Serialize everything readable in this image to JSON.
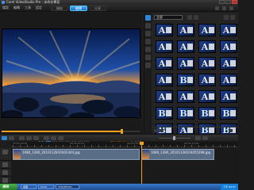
{
  "window": {
    "title": "Corel VideoStudio Pro - 未命名專案"
  },
  "menubar": {
    "menus": [
      "檔案",
      "編輯",
      "工具",
      "設定"
    ],
    "steps": [
      "擷取",
      "編輯",
      "分享"
    ],
    "active_step": "編輯"
  },
  "player": {
    "mode_labels": [
      "專案",
      "素材"
    ],
    "progress": 0.86,
    "timecode": "00:00:03:17"
  },
  "library": {
    "category": "全部",
    "thumbnails": [
      "A",
      "A",
      "A",
      "A",
      "A",
      "A",
      "A",
      "A",
      "A",
      "A",
      "A",
      "A",
      "A",
      "B",
      "A",
      "A",
      "A",
      "A",
      "A",
      "A",
      "B",
      "B",
      "B",
      "B",
      "B",
      "A",
      "B",
      "B"
    ]
  },
  "timeline": {
    "clips": [
      "1080_1280_2010112810442444.jpg",
      "1080_1280_20101128104455298.jpg"
    ],
    "ruler": [
      "00:00:00:00",
      "00:00:04:00",
      "00:00:08:00",
      "00:00:12:00"
    ]
  },
  "taskbar": {
    "start_label": "開始",
    "tasks": [
      "桌面",
      "Corel",
      "VideoStudio"
    ],
    "clock": "下午 09:27"
  },
  "colors": {
    "accent": "#2d86d6",
    "playhead": "#f0a020",
    "clip": "#5a6d86"
  }
}
